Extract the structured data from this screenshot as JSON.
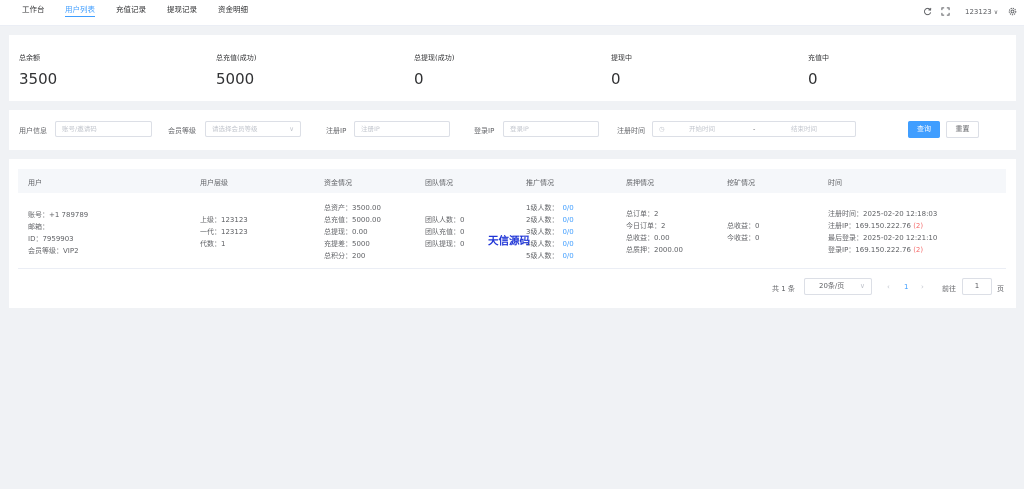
{
  "nav": {
    "tabs": [
      "工作台",
      "用户列表",
      "充值记录",
      "提现记录",
      "资金明细"
    ],
    "active_tab": 1,
    "username": "123123"
  },
  "stats": [
    {
      "label": "总余额",
      "value": "3500"
    },
    {
      "label": "总充值(成功)",
      "value": "5000"
    },
    {
      "label": "总提现(成功)",
      "value": "0"
    },
    {
      "label": "提现中",
      "value": "0"
    },
    {
      "label": "充值中",
      "value": "0"
    }
  ],
  "filters": {
    "user_info_label": "用户信息",
    "user_info_placeholder": "账号/邀请码",
    "level_label": "会员等级",
    "level_placeholder": "请选择会员等级",
    "reg_ip_label": "注册IP",
    "reg_ip_placeholder": "注册IP",
    "login_ip_label": "登录IP",
    "login_ip_placeholder": "登录IP",
    "reg_time_label": "注册时间",
    "start_placeholder": "开始时间",
    "range_sep": "-",
    "end_placeholder": "结束时间",
    "search_button": "查询",
    "reset_button": "重置"
  },
  "table": {
    "headers": [
      "用户",
      "用户层级",
      "资金情况",
      "团队情况",
      "推广情况",
      "质押情况",
      "挖矿情况",
      "时间"
    ],
    "row": {
      "user": [
        "账号：+1 789789",
        "邮箱：",
        "ID：7959903",
        "会员等级：VIP2"
      ],
      "hierarchy": [
        "上级：123123",
        "一代：123123",
        "代数：1"
      ],
      "funds": [
        "总资产：3500.00",
        "总充值：5000.00",
        "总提现：0.00",
        "充提差：5000",
        "总积分：200"
      ],
      "team": [
        "团队人数：0",
        "团队充值：0",
        "团队提现：0"
      ],
      "promotion": [
        {
          "label": "1级人数：",
          "value": "0/0"
        },
        {
          "label": "2级人数：",
          "value": "0/0"
        },
        {
          "label": "3级人数：",
          "value": "0/0"
        },
        {
          "label": "4级人数：",
          "value": "0/0"
        },
        {
          "label": "5级人数：",
          "value": "0/0"
        }
      ],
      "pledge": [
        "总订单：2",
        "今日订单：2",
        "总收益：0.00",
        "总质押：2000.00"
      ],
      "mining": [
        "总收益：0",
        "今收益：0"
      ],
      "time": {
        "reg_time": "注册时间：2025-02-20 12:18:03",
        "reg_ip": "注册IP：169.150.222.76",
        "reg_ip_count": "(2)",
        "last_login": "最后登录：2025-02-20 12:21:10",
        "login_ip": "登录IP：169.150.222.76",
        "login_ip_count": "(2)"
      }
    },
    "watermark": "天信源码"
  },
  "pagination": {
    "total": "共 1 条",
    "page_size": "20条/页",
    "current_page": "1",
    "goto_label": "前往",
    "goto_value": "1",
    "page_suffix": "页"
  },
  "icons": [
    "refresh-icon",
    "fullscreen-icon",
    "chevron-down-icon",
    "settings-icon",
    "clock-icon"
  ],
  "colors": {
    "primary": "#409eff",
    "danger": "#f56c6c",
    "watermark": "#1f35d6"
  }
}
